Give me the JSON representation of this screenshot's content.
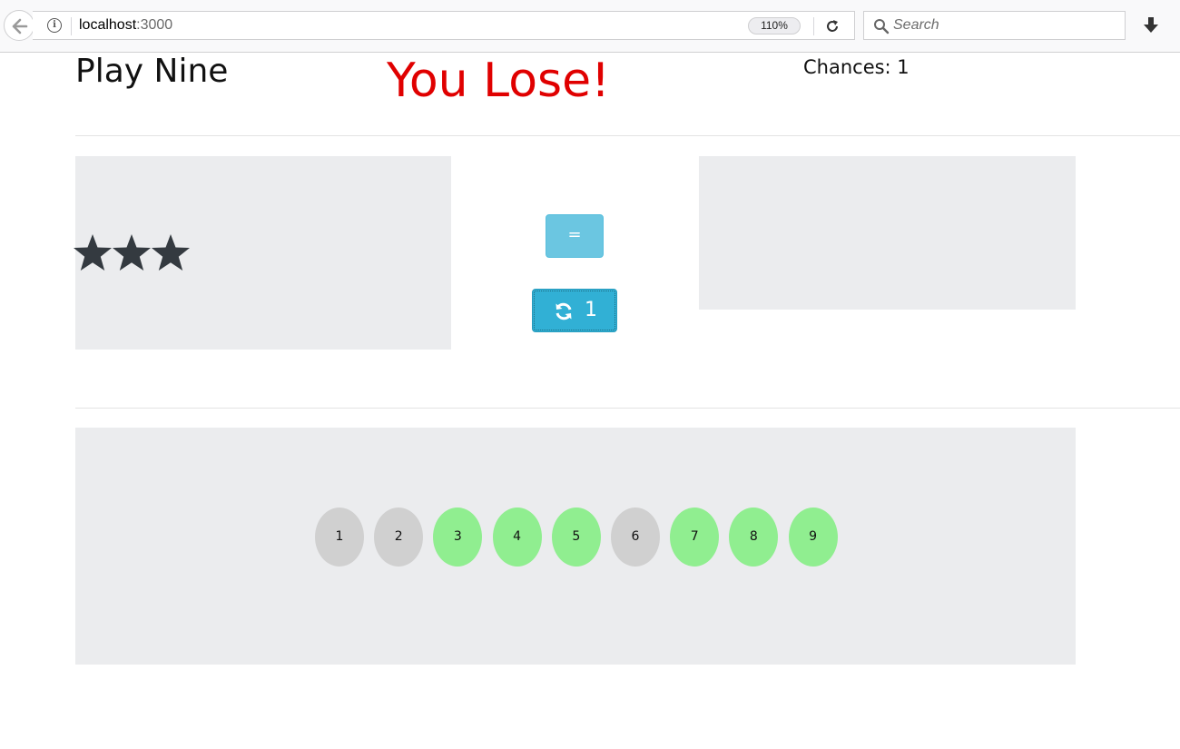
{
  "browser": {
    "url_host": "localhost",
    "url_port": ":3000",
    "zoom": "110%",
    "search_placeholder": "Search"
  },
  "game": {
    "title": "Play Nine",
    "status_message": "You Lose!",
    "status_color": "#e00000",
    "chances_label": "Chances: 1",
    "stars_count": 3,
    "equals_label": "=",
    "redraw_count": "1",
    "numbers": [
      {
        "label": "1",
        "state": "used"
      },
      {
        "label": "2",
        "state": "used"
      },
      {
        "label": "3",
        "state": "available"
      },
      {
        "label": "4",
        "state": "available"
      },
      {
        "label": "5",
        "state": "available"
      },
      {
        "label": "6",
        "state": "used"
      },
      {
        "label": "7",
        "state": "available"
      },
      {
        "label": "8",
        "state": "available"
      },
      {
        "label": "9",
        "state": "available"
      }
    ],
    "colors": {
      "used": "#d0d0d0",
      "available": "#90ee90",
      "button": "#5bc0de",
      "frame": "#ebecee"
    },
    "icons": {
      "star": "star-icon",
      "refresh": "refresh-icon"
    }
  }
}
